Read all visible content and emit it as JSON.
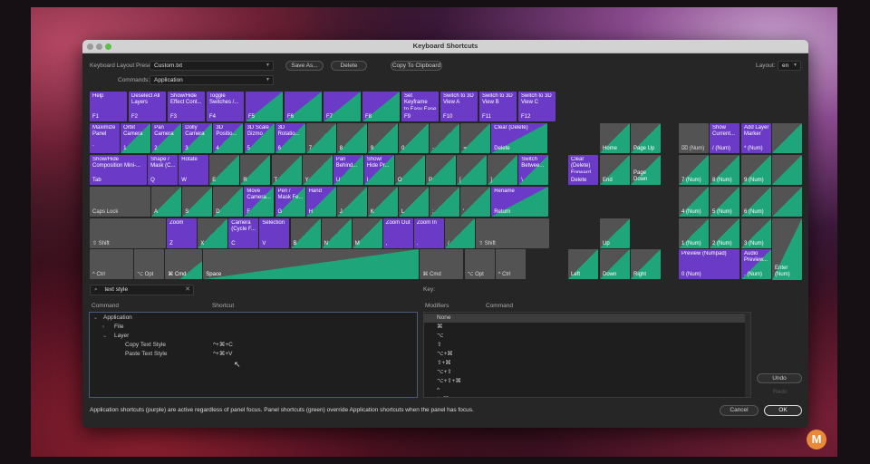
{
  "dialog": {
    "title": "Keyboard Shortcuts"
  },
  "toolbar": {
    "preset_label": "Keyboard Layout Preset:",
    "preset_value": "Custom.txt",
    "save_as": "Save As...",
    "delete": "Delete",
    "copy_clipboard": "Copy To Clipboard",
    "layout_label": "Layout:",
    "layout_value": "en",
    "commands_label": "Commands:",
    "commands_value": "Application"
  },
  "keys": {
    "f": [
      {
        "t": "Help",
        "c": "F1",
        "s": "purple"
      },
      {
        "t": "Deselect All\nLayers",
        "c": "F2",
        "s": "purple"
      },
      {
        "t": "Show/Hide\nEffect Cont...",
        "c": "F3",
        "s": "purple"
      },
      {
        "t": "Toggle\nSwitches /...",
        "c": "F4",
        "s": "purple"
      },
      {
        "t": "",
        "c": "F5",
        "s": "pg"
      },
      {
        "t": "",
        "c": "F6",
        "s": "pg"
      },
      {
        "t": "",
        "c": "F7",
        "s": "pg"
      },
      {
        "t": "",
        "c": "F8",
        "s": "pg"
      },
      {
        "t": "Set Keyframe\nto Easy Ease",
        "c": "F9",
        "s": "purple"
      },
      {
        "t": "Switch to 3D\nView A",
        "c": "F10",
        "s": "purple"
      },
      {
        "t": "Switch to 3D\nView B",
        "c": "F11",
        "s": "purple"
      },
      {
        "t": "Switch to 3D\nView C",
        "c": "F12",
        "s": "purple"
      }
    ],
    "n": [
      {
        "t": "Maximize\nPanel",
        "c": "`",
        "s": "purple"
      },
      {
        "t": "Orbit\nCamera",
        "c": "1",
        "s": "pg"
      },
      {
        "t": "Pan\nCamera",
        "c": "2",
        "s": "pg"
      },
      {
        "t": "Dolly\nCamera",
        "c": "3",
        "s": "pg"
      },
      {
        "t": "3D\nPositio...",
        "c": "4",
        "s": "pg"
      },
      {
        "t": "3D Scale\nGizmo",
        "c": "5",
        "s": "pg"
      },
      {
        "t": "3D\nRotatio...",
        "c": "6",
        "s": "pg"
      },
      {
        "t": "",
        "c": "7",
        "s": "gg"
      },
      {
        "t": "",
        "c": "8",
        "s": "gg"
      },
      {
        "t": "",
        "c": "9",
        "s": "gg"
      },
      {
        "t": "",
        "c": "0",
        "s": "gg"
      },
      {
        "t": "",
        "c": "-",
        "s": "gg"
      },
      {
        "t": "",
        "c": "=",
        "s": "gg"
      },
      {
        "t": "Clear (Delete)",
        "c": "Delete",
        "s": "pg"
      }
    ],
    "q": [
      {
        "t": "Show/Hide\nComposition Mini-...",
        "c": "Tab",
        "s": "purple"
      },
      {
        "t": "Shape /\nMask (C...",
        "c": "Q",
        "s": "purple"
      },
      {
        "t": "Rotate",
        "c": "W",
        "s": "purple"
      },
      {
        "t": "",
        "c": "E",
        "s": "gg"
      },
      {
        "t": "",
        "c": "R",
        "s": "gg"
      },
      {
        "t": "",
        "c": "T",
        "s": "gg"
      },
      {
        "t": "",
        "c": "Y",
        "s": "gg"
      },
      {
        "t": "Pan\nBehind...",
        "c": "U",
        "s": "pg"
      },
      {
        "t": "Show/\nHide Pr...",
        "c": "I",
        "s": "pg"
      },
      {
        "t": "",
        "c": "O",
        "s": "gg"
      },
      {
        "t": "",
        "c": "P",
        "s": "gg"
      },
      {
        "t": "",
        "c": "[",
        "s": "gg"
      },
      {
        "t": "",
        "c": "]",
        "s": "gg"
      },
      {
        "t": "Switch\nBetwee...",
        "c": "\\",
        "s": "pg"
      }
    ],
    "a": [
      {
        "t": "",
        "c": "Caps Lock",
        "s": "gray"
      },
      {
        "t": "",
        "c": "A",
        "s": "gg"
      },
      {
        "t": "",
        "c": "S",
        "s": "gg"
      },
      {
        "t": "",
        "c": "D",
        "s": "gg"
      },
      {
        "t": "Move\nCamera...",
        "c": "F",
        "s": "pg"
      },
      {
        "t": "Pen /\nMask Fe...",
        "c": "G",
        "s": "pg"
      },
      {
        "t": "Hand",
        "c": "H",
        "s": "pg"
      },
      {
        "t": "",
        "c": "J",
        "s": "gg"
      },
      {
        "t": "",
        "c": "K",
        "s": "gg"
      },
      {
        "t": "",
        "c": "L",
        "s": "gg"
      },
      {
        "t": "",
        "c": ";",
        "s": "gg"
      },
      {
        "t": "",
        "c": "'",
        "s": "gg"
      },
      {
        "t": "Rename",
        "c": "Return",
        "s": "pg"
      }
    ],
    "z": [
      {
        "t": "",
        "c": "⇧ Shift",
        "s": "gray"
      },
      {
        "t": "Zoom",
        "c": "Z",
        "s": "purple"
      },
      {
        "t": "",
        "c": "X",
        "s": "gg"
      },
      {
        "t": "Camera\n(Cycle F...",
        "c": "C",
        "s": "purple"
      },
      {
        "t": "Selection",
        "c": "V",
        "s": "purple"
      },
      {
        "t": "",
        "c": "B",
        "s": "gg"
      },
      {
        "t": "",
        "c": "N",
        "s": "gg"
      },
      {
        "t": "",
        "c": "M",
        "s": "gg"
      },
      {
        "t": "Zoom Out",
        "c": ",",
        "s": "purple"
      },
      {
        "t": "Zoom In",
        "c": ".",
        "s": "purple"
      },
      {
        "t": "",
        "c": "/",
        "s": "gg"
      },
      {
        "t": "",
        "c": "⇧ Shift",
        "s": "gray"
      }
    ],
    "b": [
      {
        "t": "",
        "c": "^ Ctrl",
        "s": "gray"
      },
      {
        "t": "",
        "c": "⌥ Opt",
        "s": "gray"
      },
      {
        "t": "",
        "c": "⌘ Cmd",
        "s": "gs"
      },
      {
        "t": "",
        "c": "Space",
        "s": "space"
      },
      {
        "t": "",
        "c": "⌘ Cmd",
        "s": "gray"
      },
      {
        "t": "",
        "c": "⌥ Opt",
        "s": "gray"
      },
      {
        "t": "",
        "c": "^ Ctrl",
        "s": "gray"
      }
    ],
    "nav": [
      {
        "t": "",
        "c": "Home",
        "s": "gg"
      },
      {
        "t": "",
        "c": "Page Up",
        "s": "gg"
      },
      {
        "t": "Clear\n(Delete)\nForward",
        "c": "Delete",
        "s": "purple"
      },
      {
        "t": "",
        "c": "End",
        "s": "gg"
      },
      {
        "t": "",
        "c": "Page\nDown",
        "s": "gg"
      },
      {
        "t": "",
        "c": "Up",
        "s": "gg"
      },
      {
        "t": "",
        "c": "Left",
        "s": "gg"
      },
      {
        "t": "",
        "c": "Down",
        "s": "gg"
      },
      {
        "t": "",
        "c": "Right",
        "s": "gg"
      }
    ],
    "pad": [
      {
        "t": "",
        "c": "⌧ (Num)",
        "s": "gray"
      },
      {
        "t": "Show\nCurrent...",
        "c": "/ (Num)",
        "s": "purple"
      },
      {
        "t": "Add Layer\nMarker",
        "c": "* (Num)",
        "s": "purple"
      },
      {
        "t": "",
        "c": "",
        "s": "gg"
      },
      {
        "t": "",
        "c": "7 (Num)",
        "s": "gg"
      },
      {
        "t": "",
        "c": "8 (Num)",
        "s": "gg"
      },
      {
        "t": "",
        "c": "9 (Num)",
        "s": "gg"
      },
      {
        "t": "",
        "c": "",
        "s": "gg"
      },
      {
        "t": "",
        "c": "4 (Num)",
        "s": "gg"
      },
      {
        "t": "",
        "c": "5 (Num)",
        "s": "gg"
      },
      {
        "t": "",
        "c": "6 (Num)",
        "s": "gg"
      },
      {
        "t": "",
        "c": "",
        "s": "gg"
      },
      {
        "t": "",
        "c": "1 (Num)",
        "s": "gg"
      },
      {
        "t": "",
        "c": "2 (Num)",
        "s": "gg"
      },
      {
        "t": "",
        "c": "3 (Num)",
        "s": "gg"
      },
      {
        "t": "Preview (Numpad)",
        "c": "0 (Num)",
        "s": "purple"
      },
      {
        "t": "Audio\nPreview...",
        "c": ". (Num)",
        "s": "pg"
      },
      {
        "t": "",
        "c": "Enter\n(Num)",
        "s": "gg"
      }
    ]
  },
  "search": {
    "value": "text style",
    "key_label": "Key:"
  },
  "table": {
    "col_command": "Command",
    "col_shortcut": "Shortcut",
    "rows": [
      {
        "label": "Application",
        "indent": 0,
        "caret": "⌄",
        "shortcut": ""
      },
      {
        "label": "File",
        "indent": 1,
        "caret": "›",
        "shortcut": ""
      },
      {
        "label": "Layer",
        "indent": 1,
        "caret": "⌄",
        "shortcut": ""
      },
      {
        "label": "Copy Text Style",
        "indent": 2,
        "caret": "",
        "shortcut": "^+⌘+C"
      },
      {
        "label": "Paste Text Style",
        "indent": 2,
        "caret": "",
        "shortcut": "^+⌘+V"
      }
    ]
  },
  "modifiers": {
    "col_modifiers": "Modifiers",
    "col_command": "Command",
    "items": [
      "None",
      "⌘",
      "⌥",
      "⇧",
      "⌥+⌘",
      "⇧+⌘",
      "⌥+⇧",
      "⌥+⇧+⌘",
      "^",
      "^+⌘"
    ]
  },
  "buttons": {
    "undo": "Undo",
    "redo": "Redo",
    "cancel": "Cancel",
    "ok": "OK"
  },
  "footer": {
    "note": "Application shortcuts (purple) are active regardless of panel focus. Panel shortcuts (green) override Application shortcuts when the panel has focus."
  },
  "badge": {
    "letter": "M"
  },
  "colors": {
    "app": "#6b3bc7",
    "panel": "#1fa57a",
    "unassigned": "#535353"
  }
}
